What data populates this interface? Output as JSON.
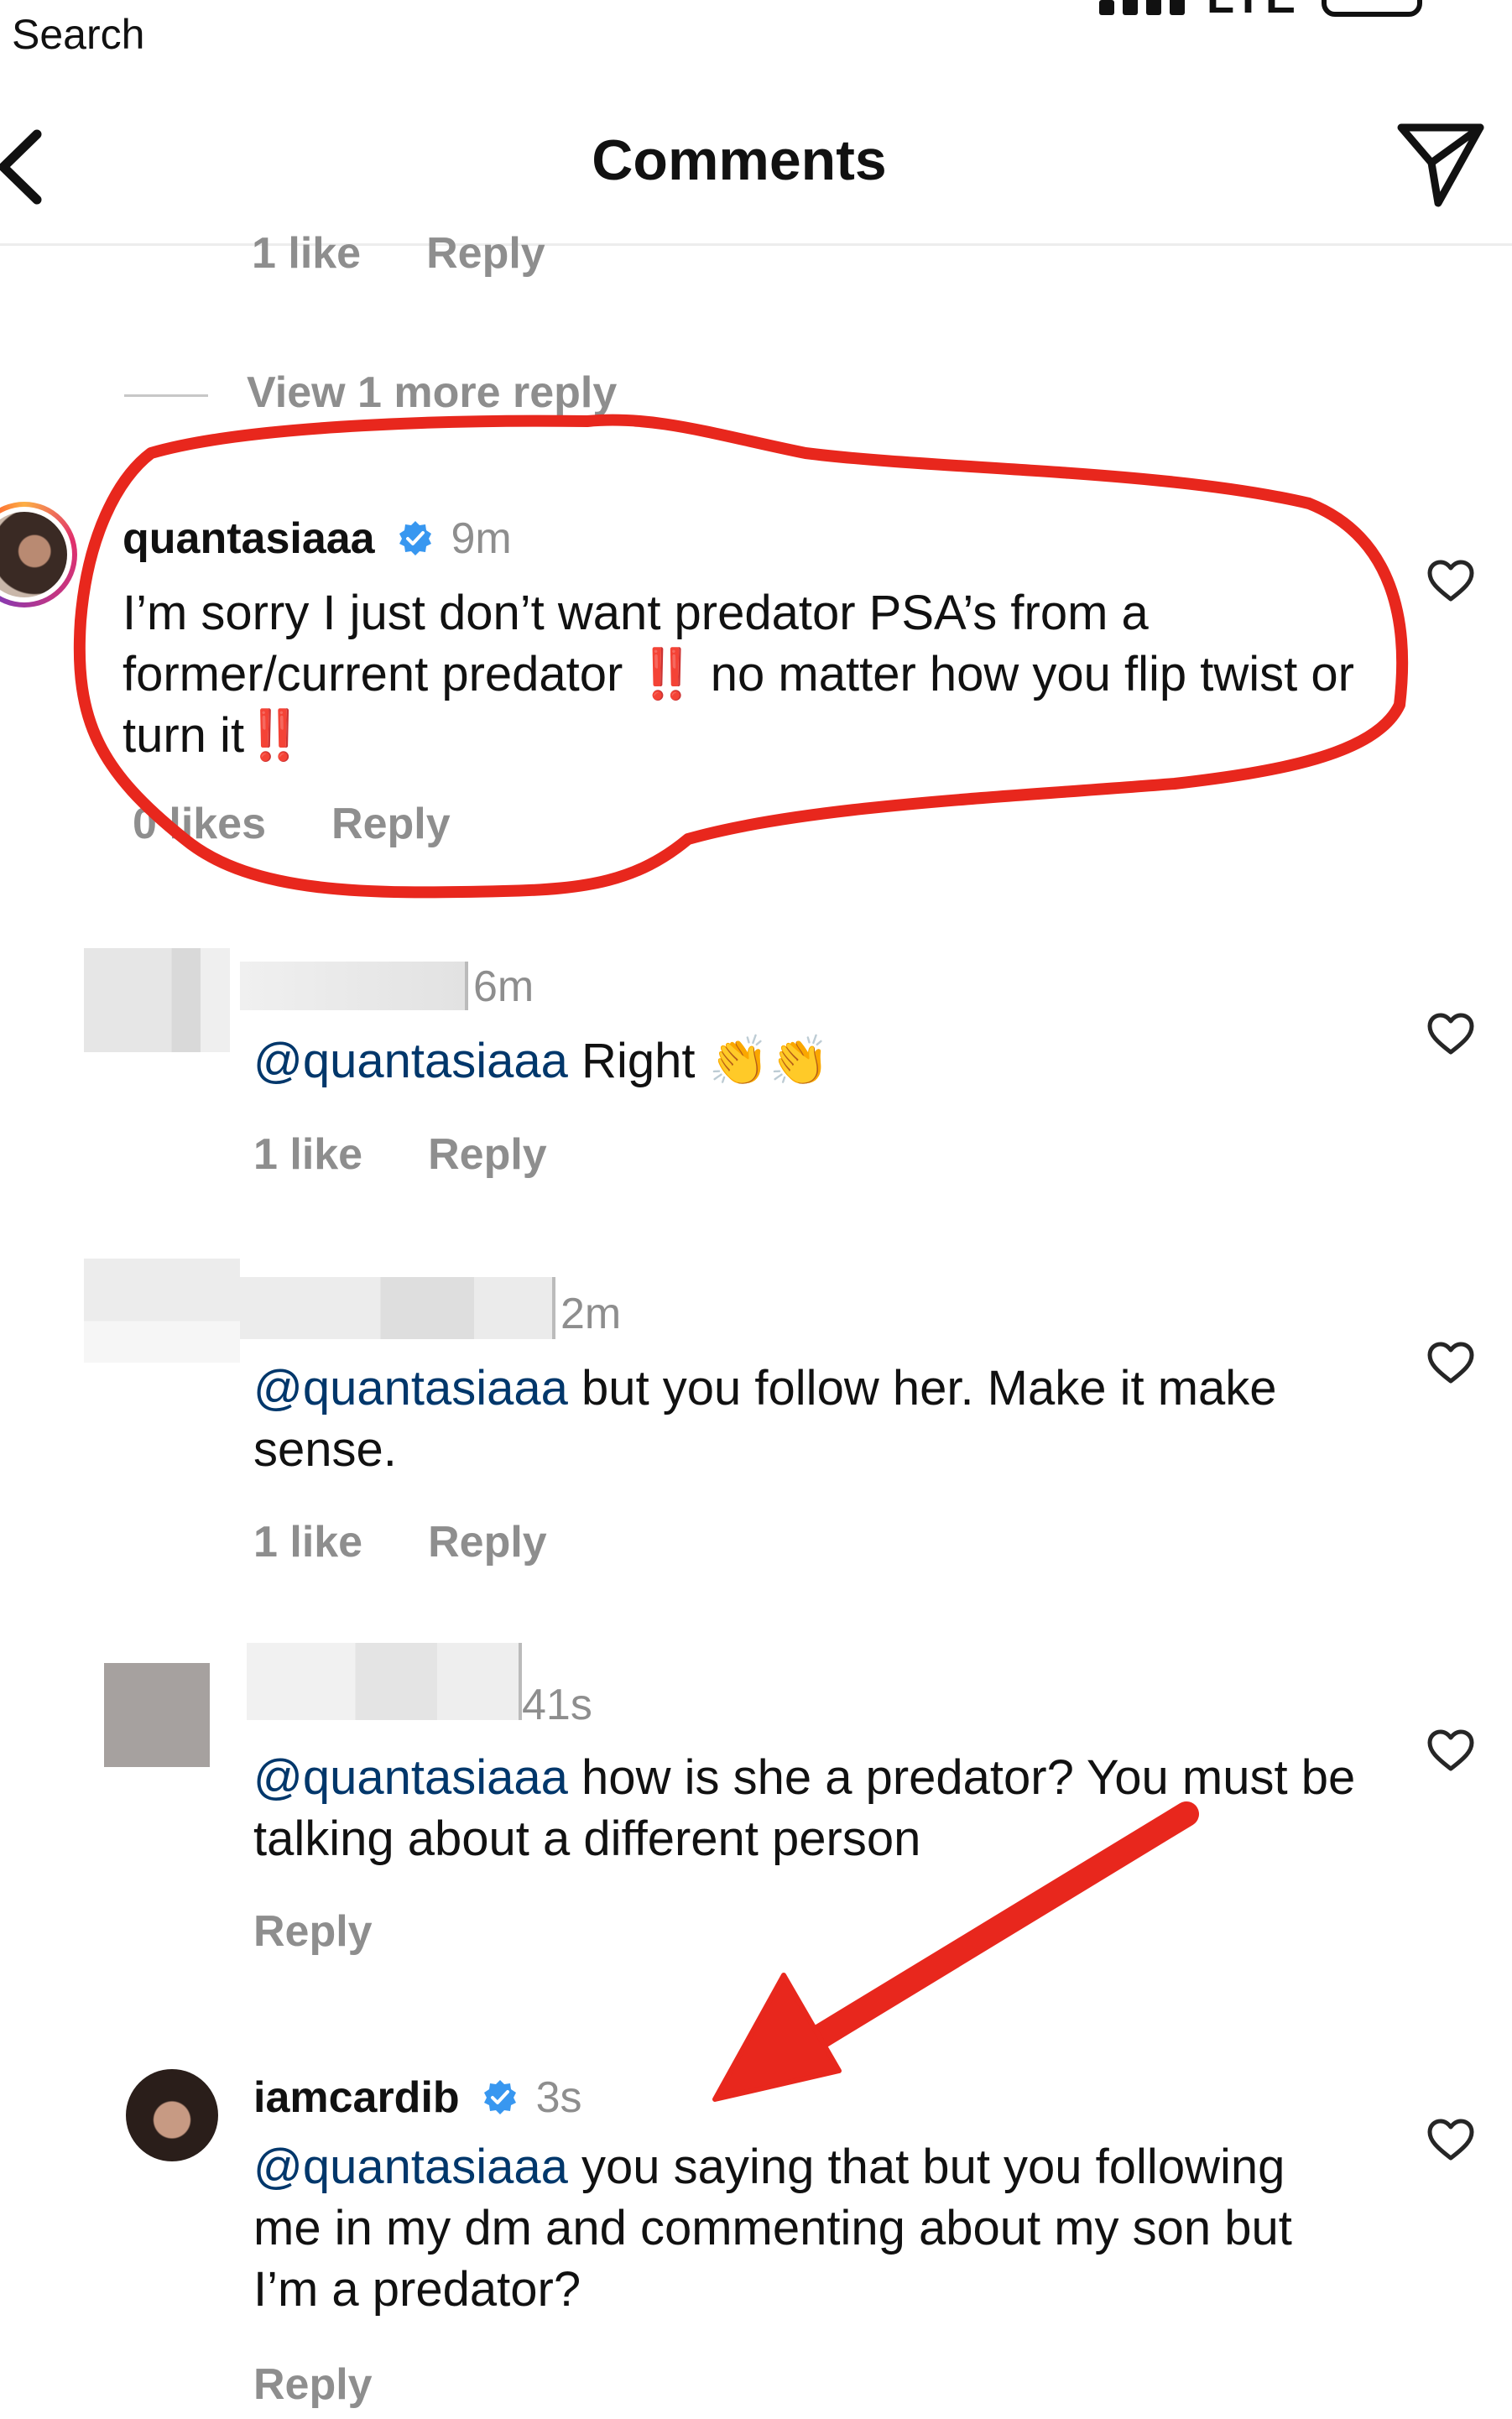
{
  "status_bar": {
    "search_label": "Search",
    "network": "LTE"
  },
  "header": {
    "title": "Comments"
  },
  "top_reply": {
    "likes": "1 like",
    "reply_label": "Reply"
  },
  "view_more": "View 1 more reply",
  "comments": [
    {
      "username": "quantasiaaa",
      "verified": true,
      "time": "9m",
      "text": "I’m sorry I just don’t want predator PSA’s from a former/current predator ‼️ no matter how you flip twist or turn it‼️",
      "likes": "0 likes",
      "reply_label": "Reply"
    },
    {
      "time": "6m",
      "mention": "@quantasiaaa",
      "text": " Right 👏👏",
      "likes": "1 like",
      "reply_label": "Reply"
    },
    {
      "time": "2m",
      "mention": "@quantasiaaa",
      "text": " but you follow her. Make it make sense.",
      "likes": "1 like",
      "reply_label": "Reply"
    },
    {
      "time": "41s",
      "mention": "@quantasiaaa",
      "text": " how is she a predator? You must be talking about a different person",
      "reply_label": "Reply"
    },
    {
      "username": "iamcardib",
      "verified": true,
      "time": "3s",
      "mention": "@quantasiaaa",
      "text": " you saying that but you following me in my dm and commenting about my son but I’m a predator?",
      "reply_label": "Reply"
    }
  ],
  "colors": {
    "mention": "#00376b",
    "muted": "#8e8e8e",
    "verified": "#3897f0",
    "annotation": "#e8271d"
  },
  "icons": {
    "back": "chevron-left-icon",
    "send": "paper-plane-icon",
    "like": "heart-outline-icon",
    "verified": "verified-badge-icon"
  }
}
